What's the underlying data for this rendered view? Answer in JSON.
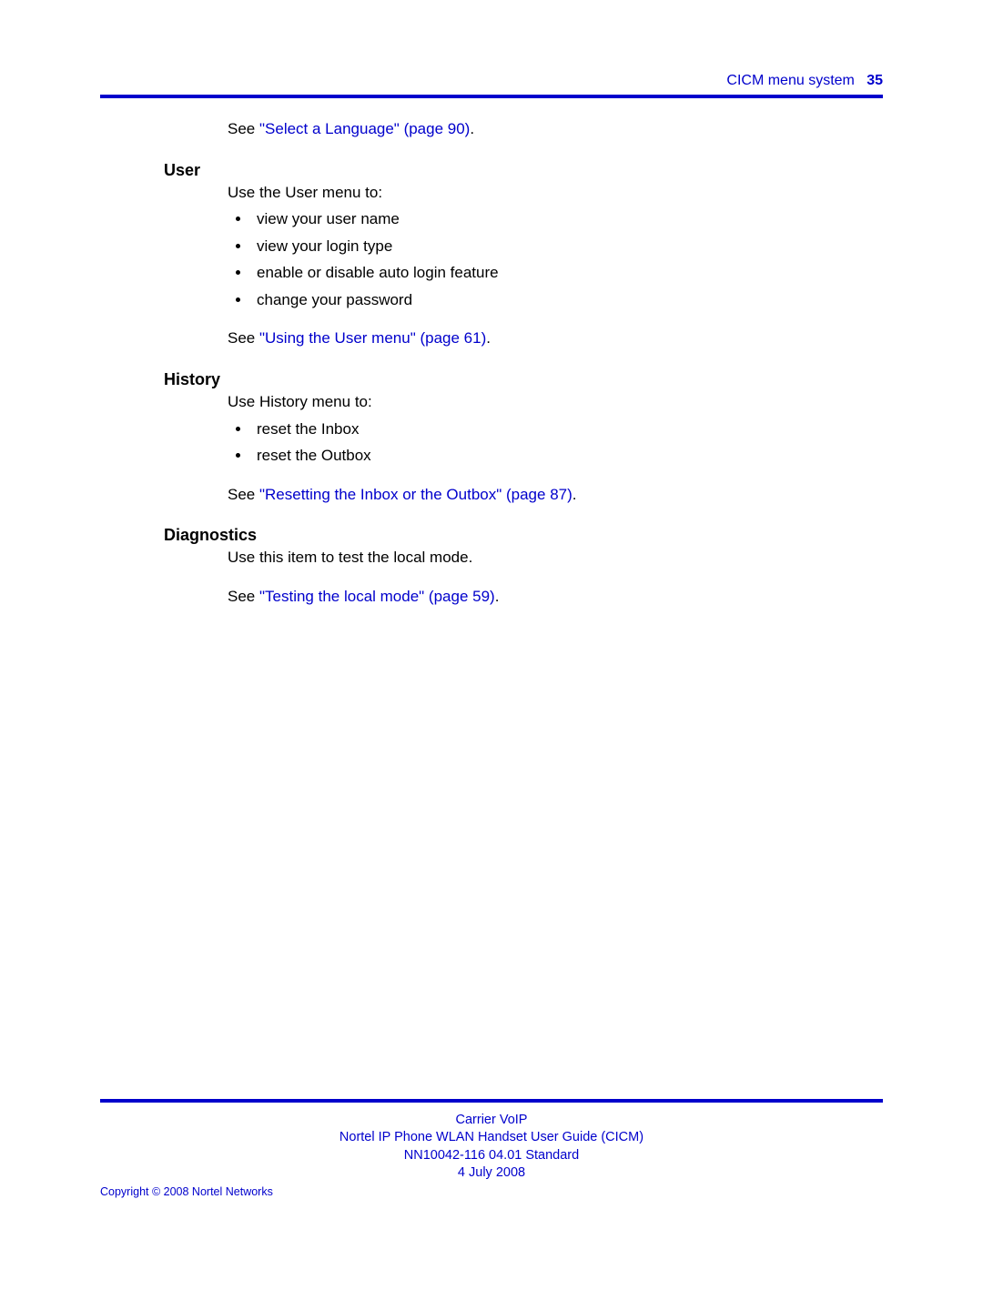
{
  "header": {
    "title": "CICM menu system",
    "page": "35"
  },
  "intro": {
    "see_prefix": "See ",
    "see_link": "\"Select a Language\" (page 90)",
    "see_suffix": "."
  },
  "sections": {
    "user": {
      "heading": "User",
      "intro": "Use the User menu to:",
      "items": [
        "view your user name",
        "view your login type",
        "enable or disable auto login feature",
        "change your password"
      ],
      "see_prefix": "See ",
      "see_link": "\"Using the User menu\" (page 61)",
      "see_suffix": "."
    },
    "history": {
      "heading": "History",
      "intro": "Use History menu to:",
      "items": [
        "reset the Inbox",
        "reset the Outbox"
      ],
      "see_prefix": "See ",
      "see_link": "\"Resetting the Inbox or the Outbox\" (page 87)",
      "see_suffix": "."
    },
    "diagnostics": {
      "heading": "Diagnostics",
      "intro": "Use this item to test the local mode.",
      "see_prefix": "See ",
      "see_link": "\"Testing the local mode\" (page 59)",
      "see_suffix": "."
    }
  },
  "footer": {
    "line1": "Carrier VoIP",
    "line2": "Nortel IP Phone WLAN Handset User Guide (CICM)",
    "line3": "NN10042-116   04.01   Standard",
    "line4": "4 July 2008",
    "copyright": "Copyright © 2008 Nortel Networks"
  }
}
